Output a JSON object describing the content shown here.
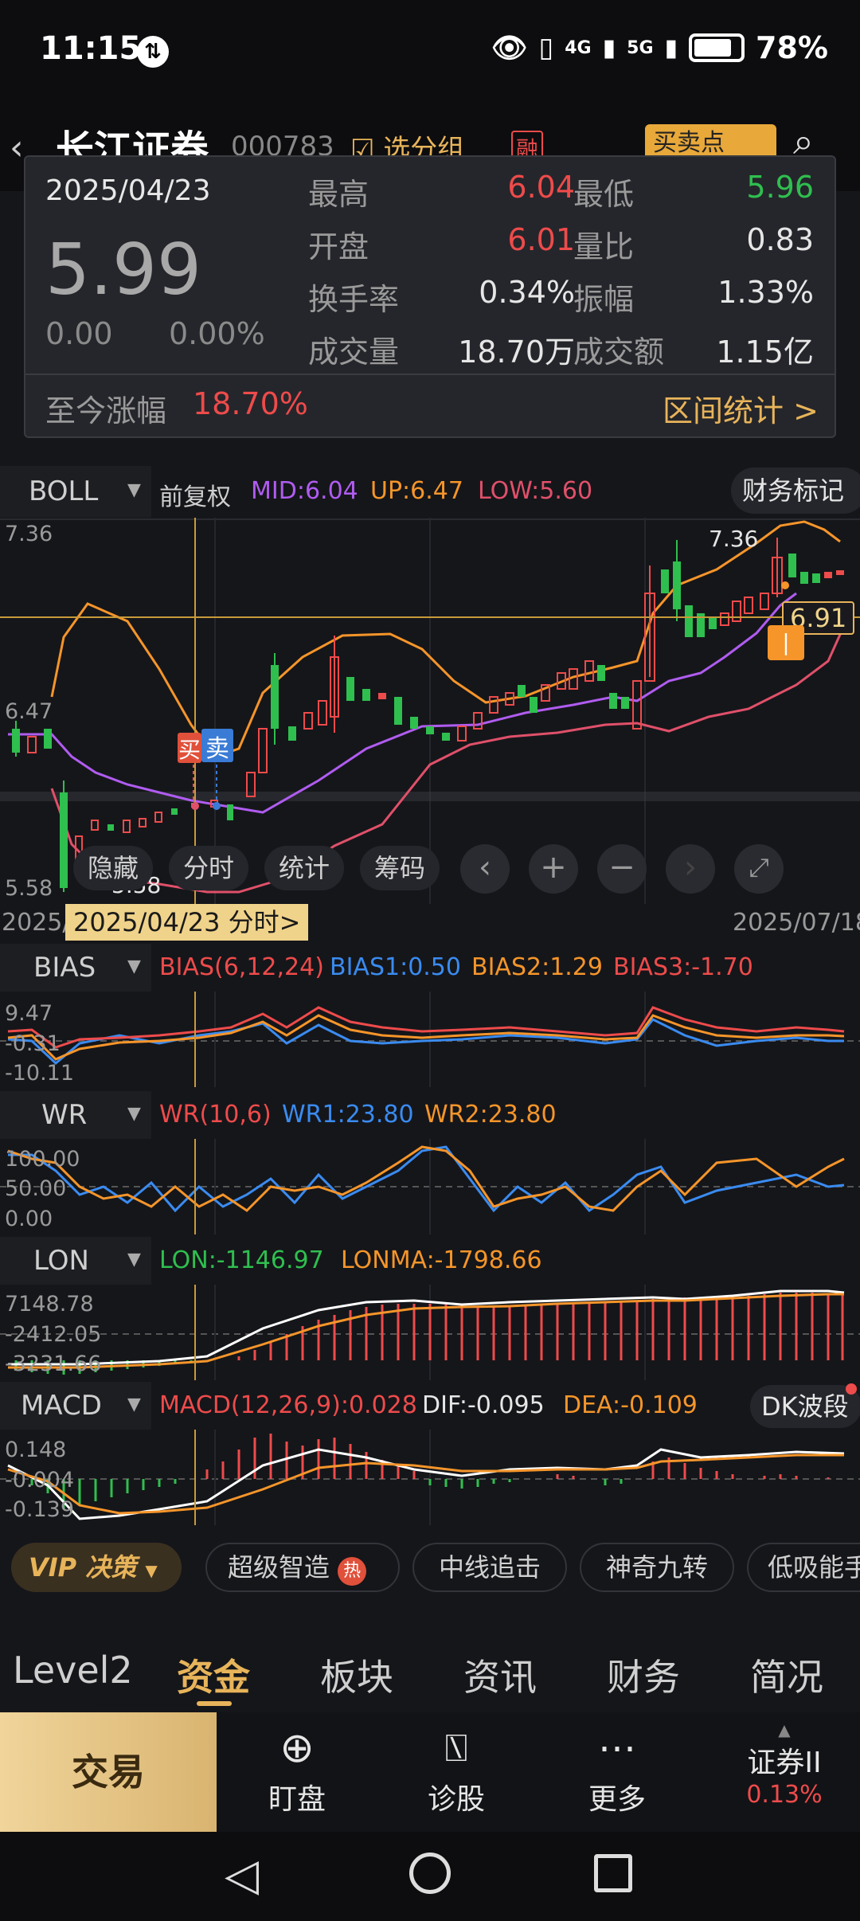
{
  "status": {
    "time": "11:15",
    "network1": "4G",
    "network2": "5G",
    "battery": "78%"
  },
  "header": {
    "title": "长江证券",
    "code": "000783",
    "group_btn": "选分组",
    "rong": "融",
    "buy_sell_btn": "买卖点"
  },
  "tooltip": {
    "date": "2025/04/23",
    "price": "5.99",
    "change": "0.00",
    "change_pct": "0.00%",
    "rows": [
      {
        "l1": "最高",
        "v1": "6.04",
        "l2": "最低",
        "v2": "5.96"
      },
      {
        "l1": "开盘",
        "v1": "6.01",
        "l2": "量比",
        "v2": "0.83"
      },
      {
        "l1": "换手率",
        "v1": "0.34%",
        "l2": "振幅",
        "v2": "1.33%"
      },
      {
        "l1": "成交量",
        "v1": "18.70万",
        "l2": "成交额",
        "v2": "1.15亿"
      }
    ],
    "since_label": "至今涨幅",
    "since_value": "18.70%",
    "interval_stats": "区间统计 >"
  },
  "boll": {
    "name": "BOLL",
    "adjust": "前复权",
    "mid": "MID:6.04",
    "up": "UP:6.47",
    "low": "LOW:5.60",
    "finance_marker": "财务标记",
    "y_top": "7.36",
    "y_mid": "6.47",
    "y_bot": "5.58",
    "high_tag": "7.36",
    "low_tag": "5.58",
    "price_tag": "6.91",
    "buy_label": "买",
    "sell_label": "卖",
    "chips": [
      "隐藏",
      "分时",
      "统计",
      "筹码"
    ]
  },
  "date_axis": {
    "left": "2025/",
    "selected": "2025/04/23 分时>",
    "right": "2025/07/18"
  },
  "bias": {
    "name": "BIAS",
    "params": "BIAS(6,12,24)",
    "b1": "BIAS1:0.50",
    "b2": "BIAS2:1.29",
    "b3": "BIAS3:-1.70",
    "y_top": "9.47",
    "y_mid": "-0.31",
    "y_bot": "-10.11"
  },
  "wr": {
    "name": "WR",
    "params": "WR(10,6)",
    "wr1": "WR1:23.80",
    "wr2": "WR2:23.80",
    "y_top": "100.00",
    "y_mid": "50.00",
    "y_bot": "0.00"
  },
  "lon": {
    "name": "LON",
    "lon": "LON:-1146.97",
    "lonma": "LONMA:-1798.66",
    "y_top": "7148.78",
    "y_mid": "-2412.05",
    "y_bot": "-3231.66"
  },
  "macd": {
    "name": "MACD",
    "params": "MACD(12,26,9):0.028",
    "dif": "DIF:-0.095",
    "dea": "DEA:-0.109",
    "dk": "DK波段",
    "y_top": "0.148",
    "y_mid": "-0.004",
    "y_bot": "-0.139"
  },
  "tools": {
    "vip": "VIP 决策",
    "hot": "热",
    "items": [
      "超级智造",
      "中线追击",
      "神奇九转",
      "低吸能手"
    ]
  },
  "tabs": [
    "Level2",
    "资金",
    "板块",
    "资讯",
    "财务",
    "简况"
  ],
  "bottom": {
    "trade": "交易",
    "items": [
      "盯盘",
      "诊股",
      "更多"
    ],
    "index_name": "证券II",
    "index_change": "0.13%"
  },
  "colors": {
    "up_red": "#ee4b4b",
    "down_green": "#2fbf4f",
    "accent_gold": "#e8b45a",
    "mid_purple": "#b05cf0",
    "up_orange": "#f5952a",
    "low_red": "#e0506a"
  }
}
